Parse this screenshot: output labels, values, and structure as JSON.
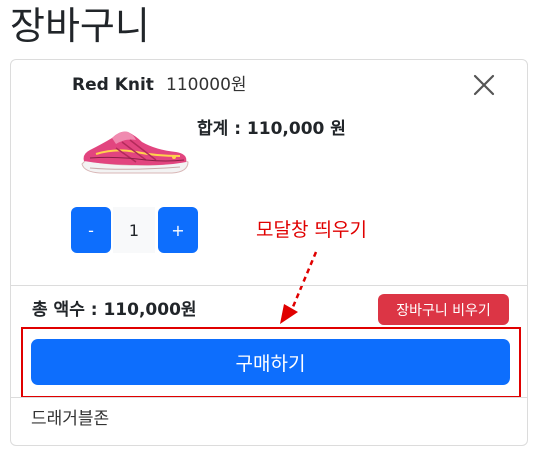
{
  "page": {
    "title": "장바구니"
  },
  "cart": {
    "item": {
      "name": "Red Knit",
      "price": "110000원",
      "subtotal": "합계 : 110,000 원",
      "quantity": "1",
      "image_icon": "sneaker-image"
    },
    "qty_minus_label": "-",
    "qty_plus_label": "+",
    "close_icon": "close-icon",
    "total": "총 액수 : 110,000원",
    "clear_label": "장바구니 비우기",
    "buy_label": "구매하기",
    "footer": "드래거블존"
  },
  "annotation": {
    "text": "모달창 띄우기",
    "color": "#e00000"
  },
  "colors": {
    "primary": "#0d6efd",
    "danger": "#dc3545",
    "annotation": "#e00000"
  }
}
